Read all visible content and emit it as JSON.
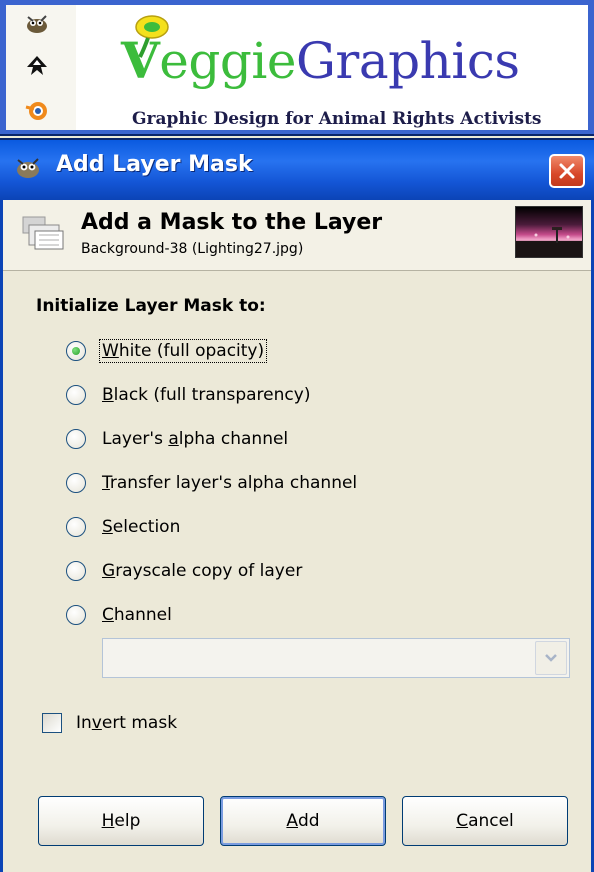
{
  "banner": {
    "logo_initial": "V",
    "logo_word_rest": "eggie",
    "logo_word_second": "Graphics",
    "tagline": "Graphic Design for Animal Rights Activists",
    "app_icons": [
      "gimp-icon",
      "inkscape-icon",
      "blender-icon"
    ]
  },
  "window": {
    "title": "Add Layer Mask",
    "close_icon": "close-icon"
  },
  "header": {
    "title": "Add a Mask to the Layer",
    "subtitle": "Background-38 (Lighting27.jpg)"
  },
  "section_label": "Initialize Layer Mask to:",
  "options": [
    {
      "pre": "",
      "mn": "W",
      "post": "hite (full opacity)",
      "checked": true,
      "focused": true
    },
    {
      "pre": "",
      "mn": "B",
      "post": "lack (full transparency)",
      "checked": false
    },
    {
      "pre": "Layer's ",
      "mn": "a",
      "post": "lpha channel",
      "checked": false
    },
    {
      "pre": "",
      "mn": "T",
      "post": "ransfer layer's alpha channel",
      "checked": false
    },
    {
      "pre": "",
      "mn": "S",
      "post": "election",
      "checked": false
    },
    {
      "pre": "",
      "mn": "G",
      "post": "rayscale copy of layer",
      "checked": false
    },
    {
      "pre": "",
      "mn": "C",
      "post": "hannel",
      "checked": false
    }
  ],
  "channel_combo": {
    "value": ""
  },
  "invert_mask": {
    "pre": "In",
    "mn": "v",
    "post": "ert mask",
    "checked": false
  },
  "buttons": {
    "help": {
      "pre": "",
      "mn": "H",
      "post": "elp"
    },
    "add": {
      "pre": "",
      "mn": "A",
      "post": "dd"
    },
    "cancel": {
      "pre": "",
      "mn": "C",
      "post": "ancel"
    }
  },
  "colors": {
    "titlebar": "#0a5ae0",
    "dialog_bg": "#ece9d8",
    "radio_checked": "#2aa12a",
    "close_button": "#d8482a"
  }
}
